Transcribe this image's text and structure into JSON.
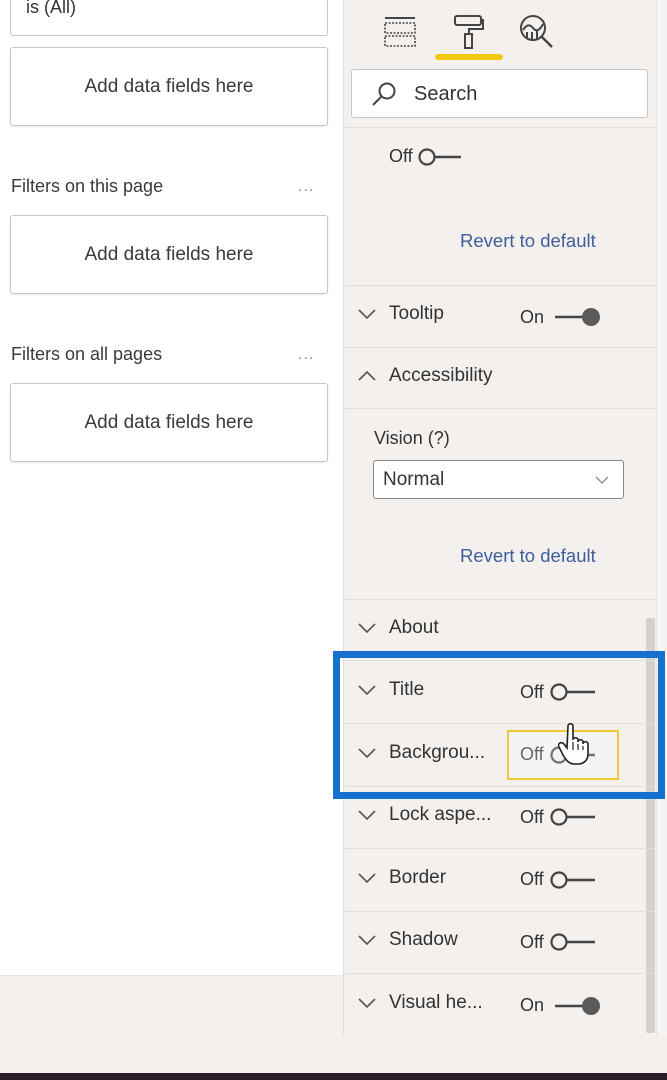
{
  "filters_pane": {
    "top_filter_value": "is (All)",
    "visual_filters_placeholder": "Add data fields here",
    "page_section": {
      "label": "Filters on this page",
      "more": "...",
      "placeholder": "Add data fields here"
    },
    "all_pages_section": {
      "label": "Filters on all pages",
      "more": "...",
      "placeholder": "Add data fields here"
    }
  },
  "format_pane": {
    "tabs": [
      {
        "name": "fields",
        "icon": "fields-icon",
        "active": false
      },
      {
        "name": "format",
        "icon": "paint-roller-icon",
        "active": true
      },
      {
        "name": "analytics",
        "icon": "analytics-magnifier-icon",
        "active": false
      }
    ],
    "accent_color": "#f2c811",
    "search": {
      "placeholder": "Search",
      "value": ""
    },
    "top_toggle": {
      "label": "Off",
      "state": false
    },
    "revert_link_1": "Revert to default",
    "tooltip": {
      "label": "Tooltip",
      "toggle_label": "On",
      "state": true
    },
    "accessibility": {
      "label": "Accessibility",
      "expanded": true,
      "vision_label": "Vision (?)",
      "vision_value": "Normal",
      "revert_link": "Revert to default"
    },
    "about": {
      "label": "About"
    },
    "sections": [
      {
        "label": "Title",
        "toggle_label": "Off",
        "state": false
      },
      {
        "label": "Backgrou...",
        "toggle_label": "Off",
        "state": false,
        "focused": true
      },
      {
        "label": "Lock aspe...",
        "toggle_label": "Off",
        "state": false
      },
      {
        "label": "Border",
        "toggle_label": "Off",
        "state": false
      },
      {
        "label": "Shadow",
        "toggle_label": "Off",
        "state": false
      },
      {
        "label": "Visual he...",
        "toggle_label": "On",
        "state": true
      }
    ],
    "highlight_color": "#1670cf",
    "focus_color": "#f0c93a"
  }
}
